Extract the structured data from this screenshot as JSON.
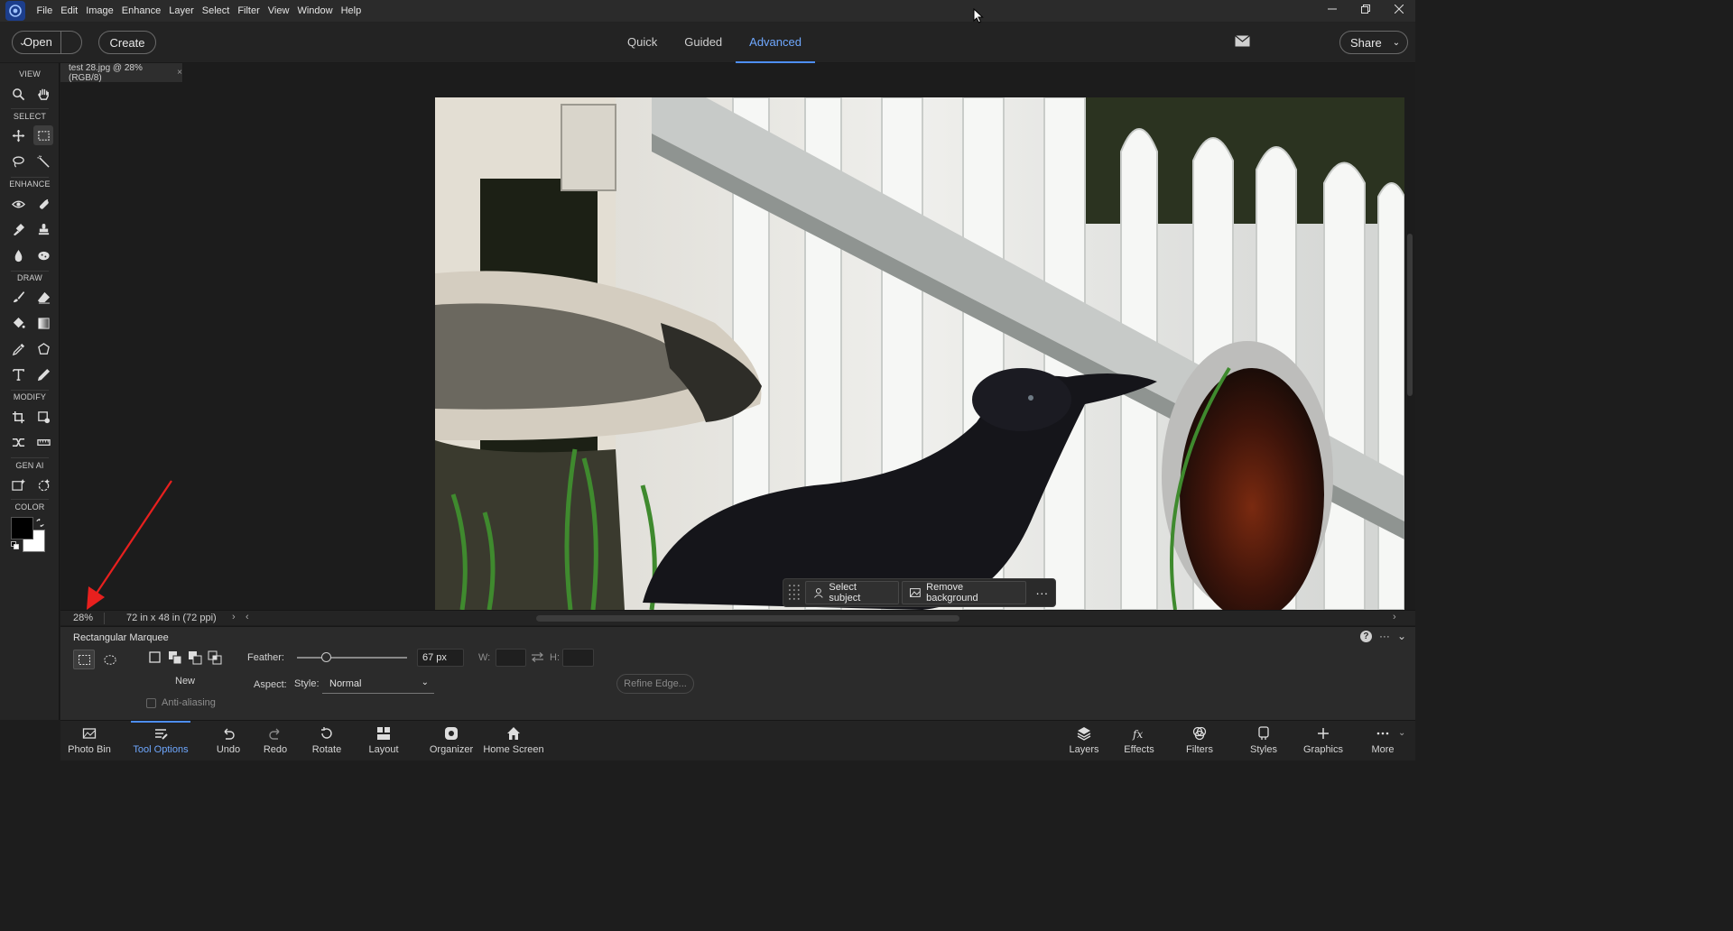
{
  "menubar": {
    "items": [
      "File",
      "Edit",
      "Image",
      "Enhance",
      "Layer",
      "Select",
      "Filter",
      "View",
      "Window",
      "Help"
    ]
  },
  "header": {
    "open_label": "Open",
    "create_label": "Create",
    "modes": [
      "Quick",
      "Guided",
      "Advanced"
    ],
    "active_mode": "Advanced",
    "share_label": "Share"
  },
  "toolbox": {
    "sections": {
      "view": "VIEW",
      "select": "SELECT",
      "enhance": "ENHANCE",
      "draw": "DRAW",
      "modify": "MODIFY",
      "genai": "GEN AI",
      "color": "COLOR"
    },
    "foreground_color": "#000000",
    "background_color": "#ffffff"
  },
  "document": {
    "tab_title": "test 28.jpg @ 28% (RGB/8)",
    "zoom": "28%",
    "info": "72 in x 48 in (72 ppi)"
  },
  "taskbar": {
    "select_subject": "Select subject",
    "remove_background": "Remove background"
  },
  "tool_options": {
    "title": "Rectangular Marquee",
    "new_label": "New",
    "feather_label": "Feather:",
    "feather_value": "67 px",
    "w_label": "W:",
    "h_label": "H:",
    "aspect_label": "Aspect:",
    "style_label": "Style:",
    "style_value": "Normal",
    "anti_alias_label": "Anti-aliasing",
    "refine_edge": "Refine Edge..."
  },
  "bottombar": {
    "left": [
      "Photo Bin",
      "Tool Options",
      "Undo",
      "Redo",
      "Rotate",
      "Layout",
      "Organizer",
      "Home Screen"
    ],
    "right": [
      "Layers",
      "Effects",
      "Filters",
      "Styles",
      "Graphics",
      "More"
    ],
    "active": "Tool Options"
  },
  "colors": {
    "accent": "#4d8ef7",
    "annotation_arrow": "#e8201e"
  }
}
